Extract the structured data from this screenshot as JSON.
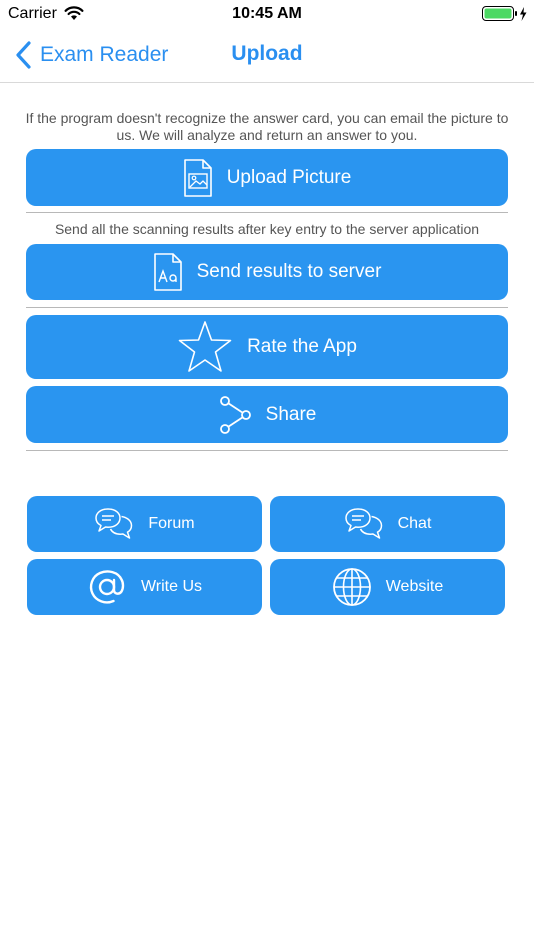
{
  "status_bar": {
    "carrier": "Carrier",
    "time": "10:45 AM"
  },
  "nav": {
    "back_label": "Exam Reader",
    "title": "Upload"
  },
  "upload_section": {
    "hint": "If the program doesn't recognize the answer card, you can email the picture to us. We will analyze and return an answer to you.",
    "button_label": "Upload Picture",
    "icon": "image-file-icon"
  },
  "send_section": {
    "hint": "Send all the scanning results after key entry to the server application",
    "button_label": "Send results to server",
    "icon": "text-file-icon"
  },
  "rate_button": {
    "label": "Rate the App",
    "icon": "star-icon"
  },
  "share_button": {
    "label": "Share",
    "icon": "share-icon"
  },
  "grid_buttons": [
    {
      "label": "Forum",
      "icon": "chat-bubbles-icon"
    },
    {
      "label": "Chat",
      "icon": "chat-bubbles-icon"
    },
    {
      "label": "Write Us",
      "icon": "at-sign-icon"
    },
    {
      "label": "Website",
      "icon": "globe-icon"
    }
  ],
  "colors": {
    "accent": "#2a8ff0",
    "button": "#2a95f0",
    "battery": "#4cd964"
  }
}
